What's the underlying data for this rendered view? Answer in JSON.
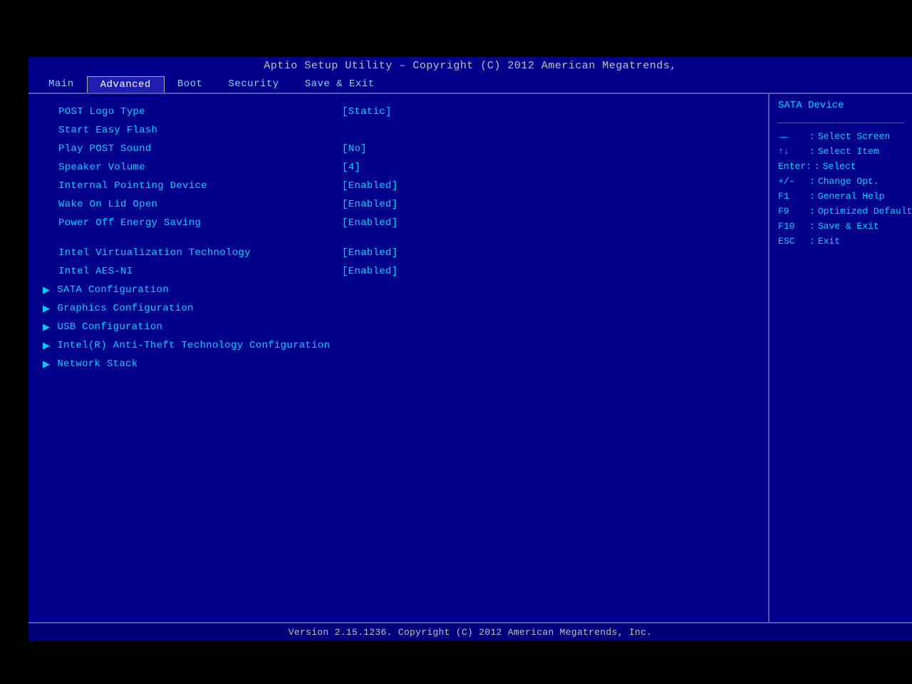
{
  "title_bar": {
    "text": "Aptio Setup Utility – Copyright (C) 2012 American Megatrends,"
  },
  "nav": {
    "tabs": [
      {
        "label": "Main",
        "active": false
      },
      {
        "label": "Advanced",
        "active": true
      },
      {
        "label": "Boot",
        "active": false
      },
      {
        "label": "Security",
        "active": false
      },
      {
        "label": "Save & Exit",
        "active": false
      }
    ]
  },
  "menu": {
    "items": [
      {
        "label": "POST Logo Type",
        "value": "[Static]",
        "submenu": false,
        "arrow": false
      },
      {
        "label": "Start Easy Flash",
        "value": "",
        "submenu": false,
        "arrow": false
      },
      {
        "label": "Play POST Sound",
        "value": "[No]",
        "submenu": false,
        "arrow": false
      },
      {
        "label": "Speaker Volume",
        "value": "[4]",
        "submenu": false,
        "arrow": false
      },
      {
        "label": "Internal Pointing Device",
        "value": "[Enabled]",
        "submenu": false,
        "arrow": false
      },
      {
        "label": "Wake On Lid Open",
        "value": "[Enabled]",
        "submenu": false,
        "arrow": false
      },
      {
        "label": "Power Off Energy Saving",
        "value": "[Enabled]",
        "submenu": false,
        "arrow": false
      },
      {
        "spacer": true
      },
      {
        "label": "Intel Virtualization Technology",
        "value": "[Enabled]",
        "submenu": false,
        "arrow": false
      },
      {
        "label": "Intel AES-NI",
        "value": "[Enabled]",
        "submenu": false,
        "arrow": false
      },
      {
        "label": "SATA Configuration",
        "value": "",
        "submenu": true,
        "arrow": true
      },
      {
        "label": "Graphics Configuration",
        "value": "",
        "submenu": true,
        "arrow": true
      },
      {
        "label": "USB Configuration",
        "value": "",
        "submenu": true,
        "arrow": true
      },
      {
        "label": "Intel(R) Anti-Theft Technology Configuration",
        "value": "",
        "submenu": true,
        "arrow": true
      },
      {
        "label": "Network Stack",
        "value": "",
        "submenu": true,
        "arrow": true
      }
    ]
  },
  "help_panel": {
    "title": "SATA Device",
    "keys": [
      {
        "key": "→←",
        "action": "Select Screen"
      },
      {
        "key": "↑↓",
        "action": "Select Item"
      },
      {
        "key": "Enter:",
        "action": "Select"
      },
      {
        "key": "+/-",
        "action": "Change Opt."
      },
      {
        "key": "F1",
        "action": "General Help"
      },
      {
        "key": "F9",
        "action": "Optimized Defaults"
      },
      {
        "key": "F10",
        "action": "Save & Exit"
      },
      {
        "key": "ESC",
        "action": "Exit"
      }
    ]
  },
  "status_bar": {
    "text": "Version 2.15.1236. Copyright (C) 2012 American Megatrends, Inc."
  }
}
